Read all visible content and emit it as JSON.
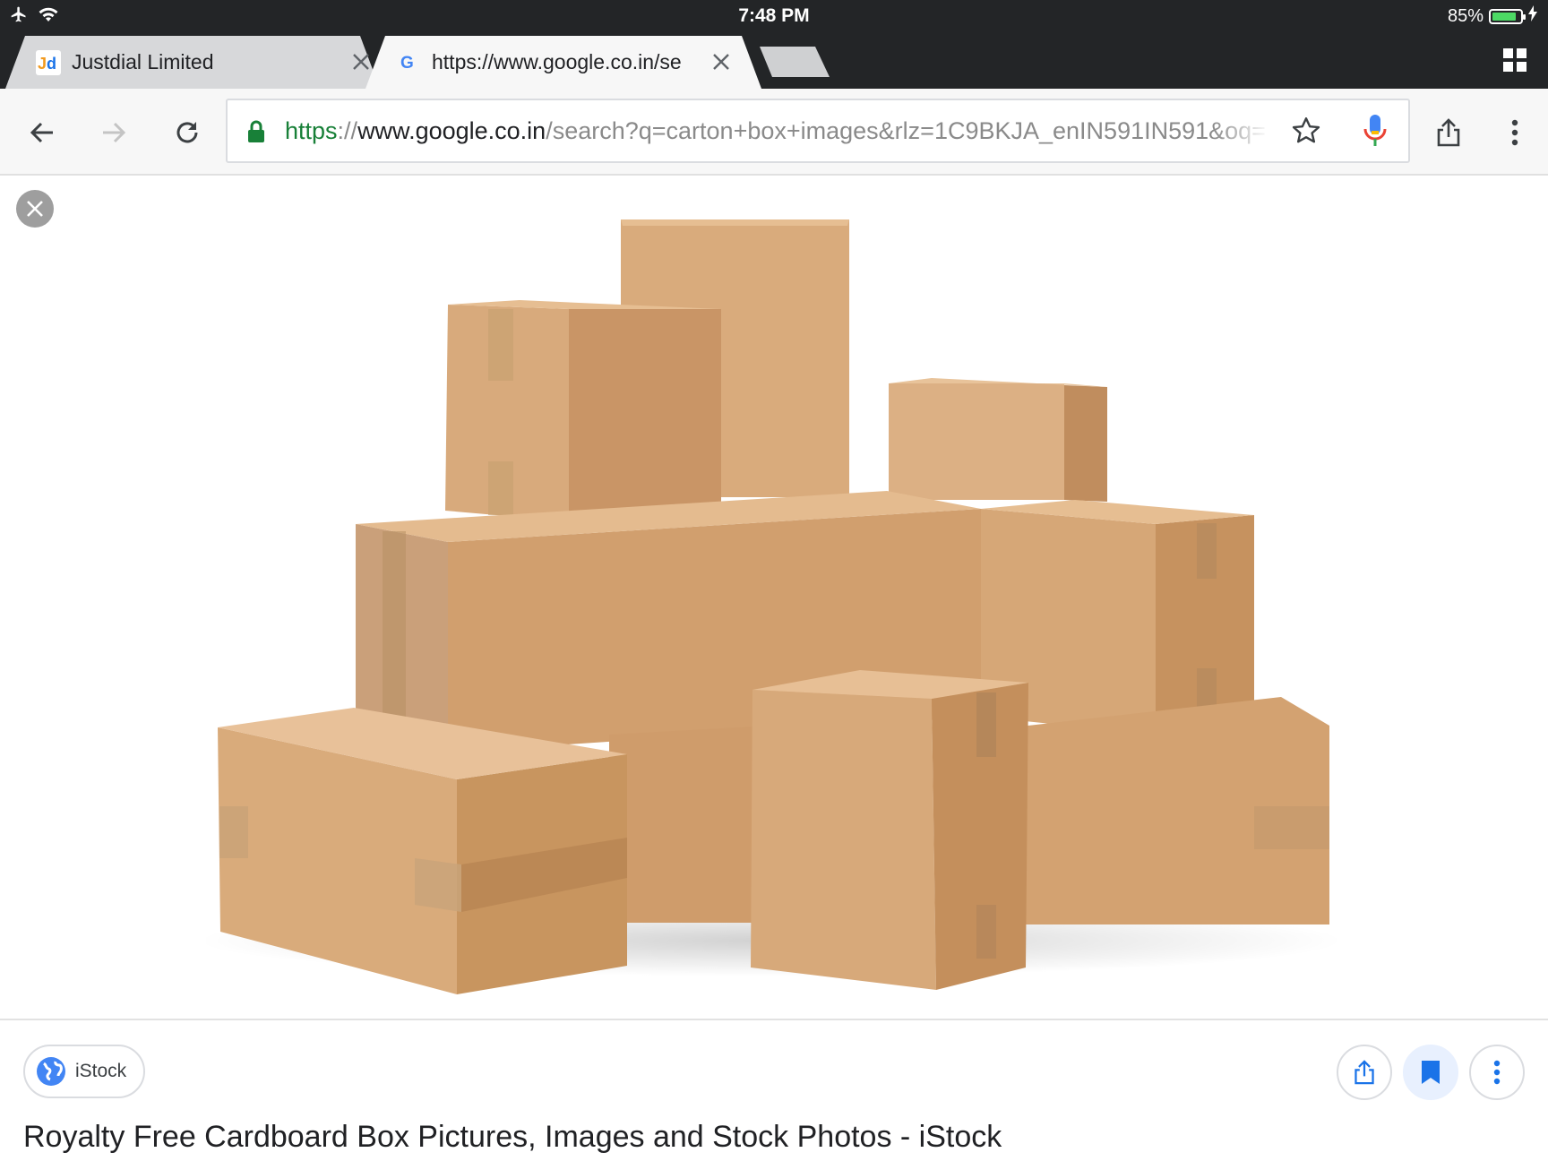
{
  "status_bar": {
    "time": "7:48 PM",
    "battery_percent": "85%",
    "battery_level": 0.85,
    "icons": [
      "airplane-icon",
      "wifi-icon",
      "battery-icon",
      "charging-icon"
    ]
  },
  "tabs": [
    {
      "title": "Justdial Limited",
      "favicon": "justdial-favicon",
      "active": false
    },
    {
      "title": "https://www.google.co.in/se",
      "favicon": "google-favicon",
      "active": true
    }
  ],
  "toolbar": {
    "url_scheme": "https",
    "url_separator": "://",
    "url_host": "www.google.co.in",
    "url_path": "/search?q=carton+box+images&rlz=1C9BKJA_enIN591IN591&oq=",
    "icons": [
      "back-icon",
      "forward-icon",
      "reload-icon",
      "lock-icon",
      "star-icon",
      "mic-icon",
      "share-icon",
      "more-icon",
      "tab-switcher-icon"
    ]
  },
  "image_viewer": {
    "source_label": "iStock",
    "title": "Royalty Free Cardboard Box Pictures, Images and Stock Photos - iStock",
    "icons": [
      "close-icon",
      "globe-icon",
      "share-icon",
      "bookmark-icon",
      "more-vert-icon"
    ]
  },
  "colors": {
    "chrome_dark": "#232527",
    "toolbar_bg": "#f7f7f7",
    "secure_green": "#188038",
    "accent_blue": "#1a73e8",
    "cardboard": "#d1a273"
  }
}
